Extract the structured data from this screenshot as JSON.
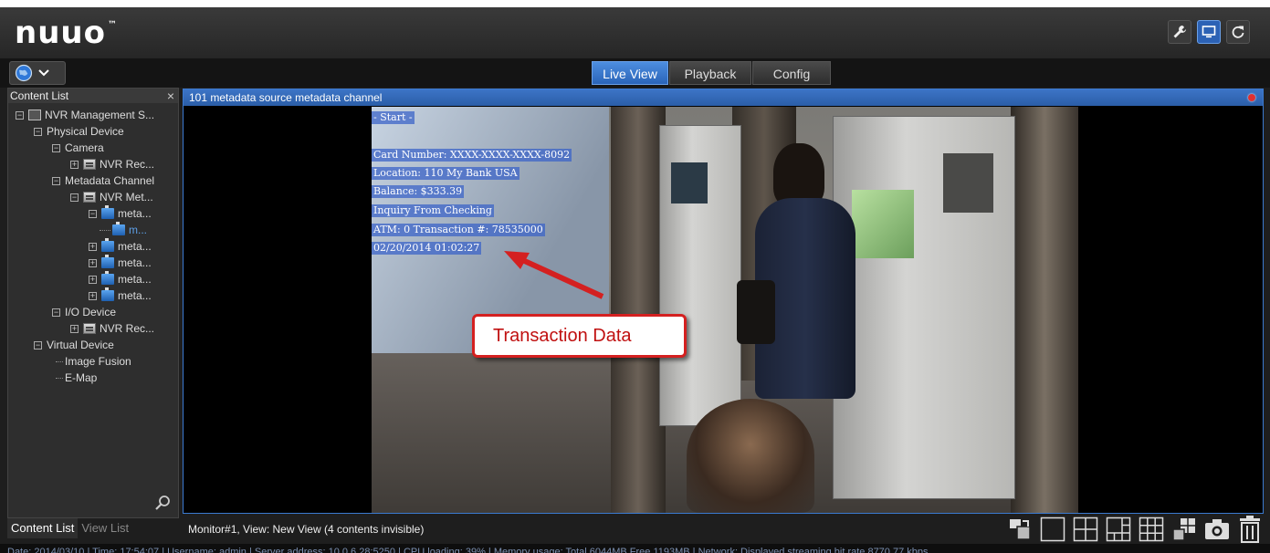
{
  "header": {
    "logo": "nuuo",
    "logo_tm": "™",
    "icons": [
      "wrench-icon",
      "monitor-icon",
      "logout-icon"
    ]
  },
  "toolbar": {
    "globe_icon": "globe-icon",
    "tabs": [
      {
        "label": "Live View",
        "active": true
      },
      {
        "label": "Playback",
        "active": false
      },
      {
        "label": "Config",
        "active": false
      }
    ]
  },
  "sidebar": {
    "title": "Content List",
    "close": "×",
    "tree": [
      {
        "label": "NVR Management S..."
      },
      {
        "label": "Physical Device"
      },
      {
        "label": "Camera"
      },
      {
        "label": "NVR Rec..."
      },
      {
        "label": "Metadata Channel"
      },
      {
        "label": "NVR Met..."
      },
      {
        "label": "meta..."
      },
      {
        "label": "m..."
      },
      {
        "label": "meta..."
      },
      {
        "label": "meta..."
      },
      {
        "label": "meta..."
      },
      {
        "label": "meta..."
      },
      {
        "label": "I/O Device"
      },
      {
        "label": "NVR Rec..."
      },
      {
        "label": "Virtual Device"
      },
      {
        "label": "Image Fusion"
      },
      {
        "label": "E-Map"
      }
    ],
    "bottom_tabs": [
      {
        "label": "Content List",
        "active": true
      },
      {
        "label": "View List",
        "active": false
      }
    ]
  },
  "viewer": {
    "title": "101  metadata source  metadata channel",
    "overlay": {
      "start": "- Start -",
      "card": "Card Number: XXXX-XXXX-XXXX-8092",
      "location": "Location: 110 My Bank USA",
      "balance": "Balance: $333.39",
      "inquiry": "Inquiry From Checking",
      "atm": "ATM: 0  Transaction #: 78535000",
      "date": "02/20/2014 01:02:27"
    },
    "callout": "Transaction Data"
  },
  "status": {
    "monitor": "Monitor#1, View: New View (4 contents invisible)"
  },
  "footer": {
    "text": "Date: 2014/03/10  |  Time: 17:54:07  |  Username: admin  |  Server address: 10.0.6.28:5250  |  CPU loading: 39%  |  Memory usage: Total 6044MB  Free 1193MB  |  Network: Displayed streaming bit rate  8770.77 kbps"
  },
  "colors": {
    "accent": "#2c62b5",
    "callout_border": "#d42020"
  }
}
